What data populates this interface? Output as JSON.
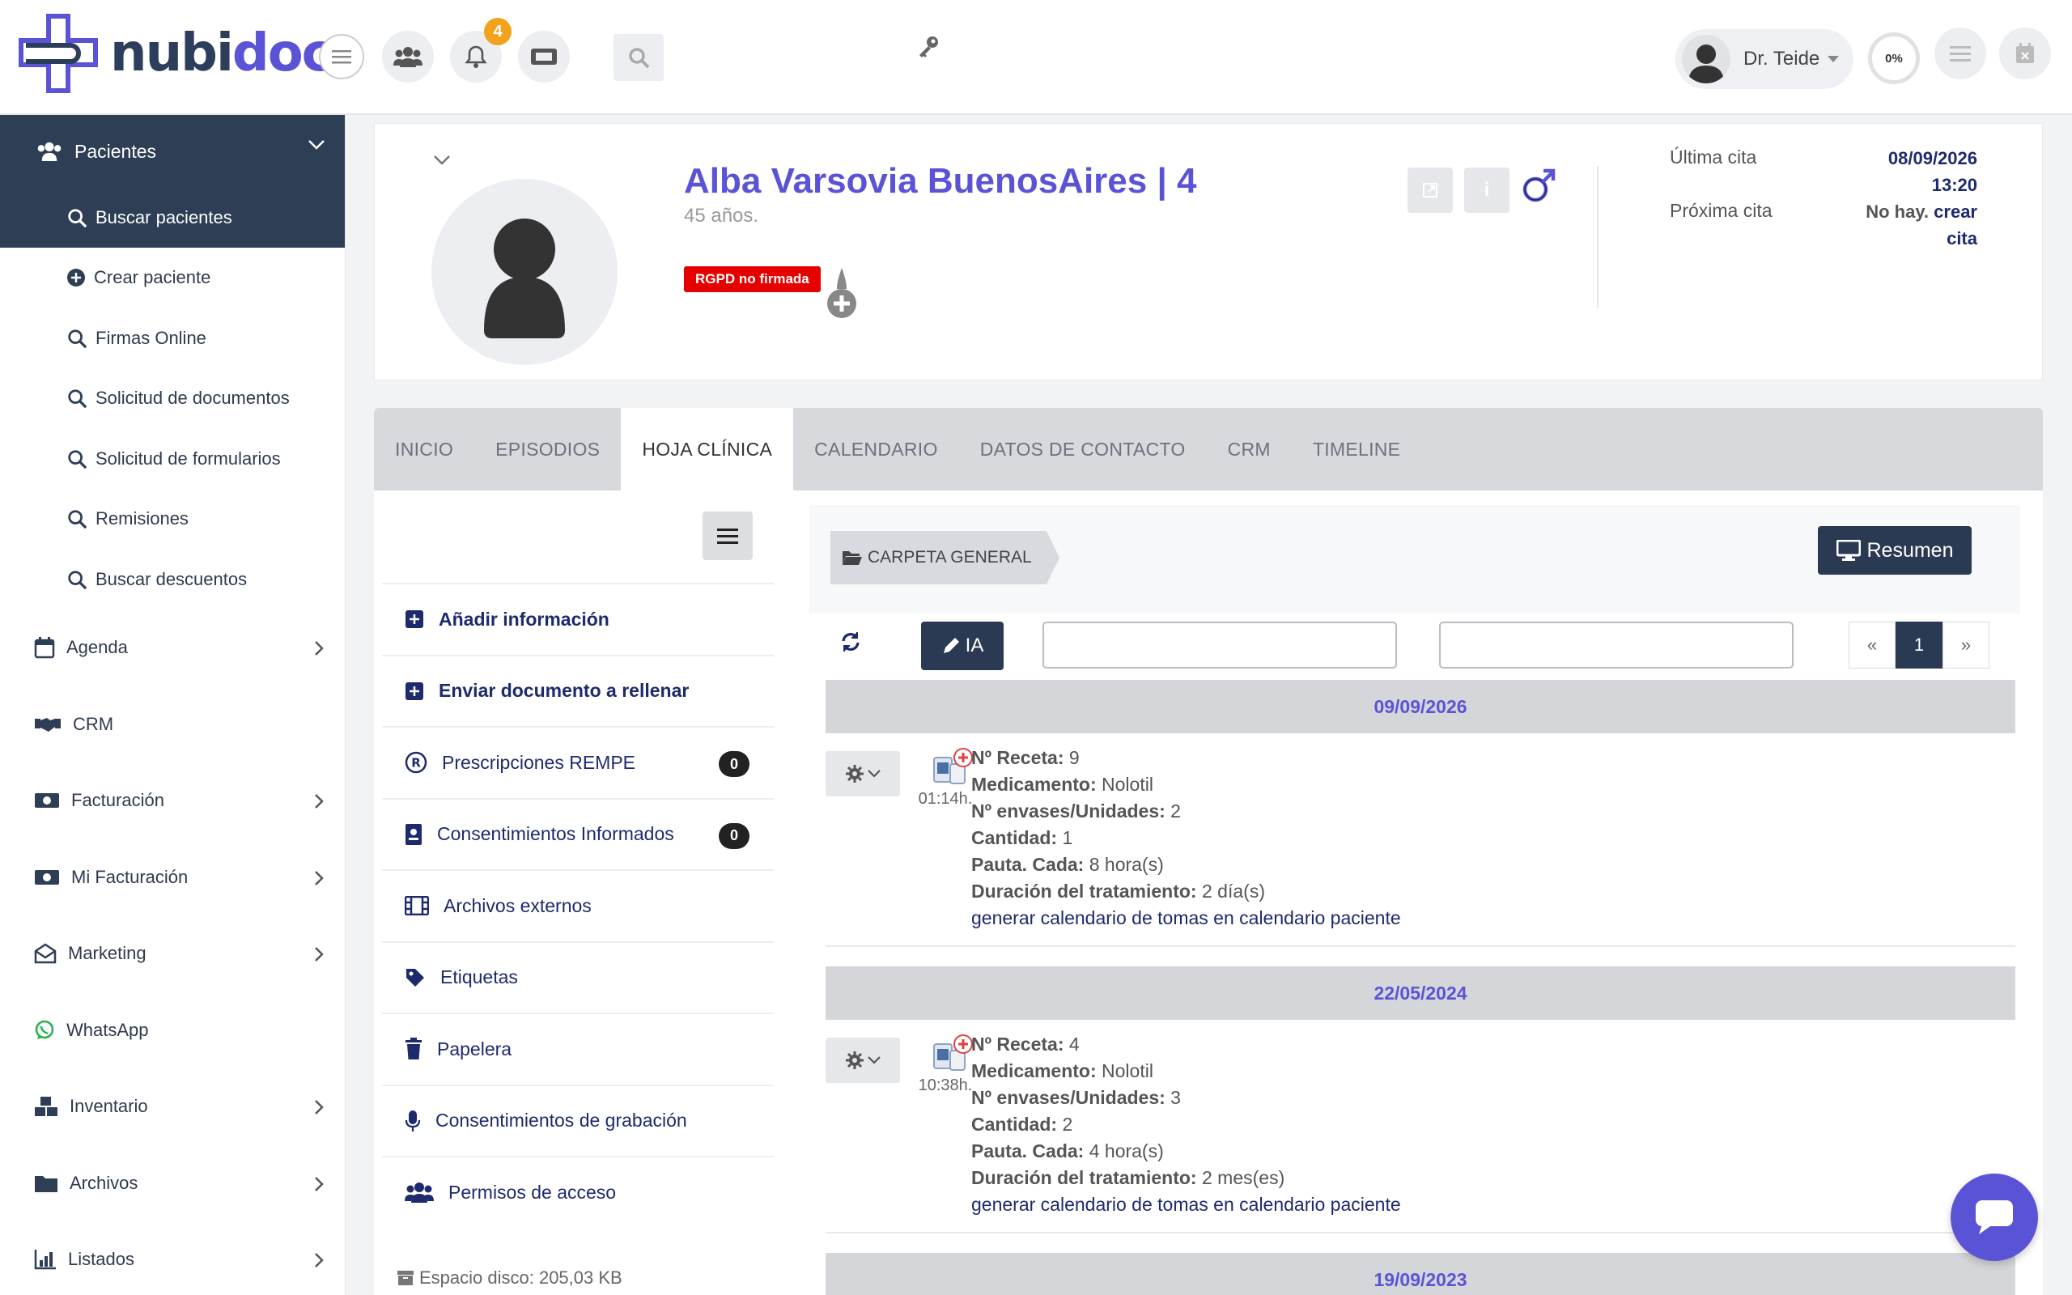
{
  "app": {
    "logo_part1": "nubi",
    "logo_part2": "doc"
  },
  "header": {
    "notifications_count": "4",
    "user_name": "Dr. Teide",
    "progress_label": "0%"
  },
  "sidebar": {
    "section": "Pacientes",
    "active_sub": "Buscar pacientes",
    "sub_items": [
      "Crear paciente",
      "Firmas Online",
      "Solicitud de documentos",
      "Solicitud de formularios",
      "Remisiones",
      "Buscar descuentos"
    ],
    "items": [
      "Agenda",
      "CRM",
      "Facturación",
      "Mi Facturación",
      "Marketing",
      "WhatsApp",
      "Inventario",
      "Archivos",
      "Listados"
    ]
  },
  "patient": {
    "name": "Alba Varsovia BuenosAires | 4",
    "age": "45 años.",
    "rgpd_badge": "RGPD no firmada",
    "last_appt_label": "Última cita",
    "last_appt_date": "08/09/2026",
    "last_appt_time": "13:20",
    "next_appt_label": "Próxima cita",
    "next_appt_none": "No hay.",
    "next_appt_link1": "crear",
    "next_appt_link2": "cita",
    "info_btn": "i"
  },
  "tabs": [
    "INICIO",
    "EPISODIOS",
    "HOJA CLÍNICA",
    "CALENDARIO",
    "DATOS DE CONTACTO",
    "CRM",
    "TIMELINE"
  ],
  "left_menu": {
    "items": [
      {
        "label": "Añadir información"
      },
      {
        "label": "Enviar documento a rellenar"
      },
      {
        "label": "Prescripciones REMPE",
        "count": "0"
      },
      {
        "label": "Consentimientos Informados",
        "count": "0"
      },
      {
        "label": "Archivos externos"
      },
      {
        "label": "Etiquetas"
      },
      {
        "label": "Papelera"
      },
      {
        "label": "Consentimientos de grabación"
      },
      {
        "label": "Permisos de acceso"
      }
    ],
    "disk_space": "Espacio disco: 205,03 KB"
  },
  "folder": {
    "breadcrumb": "CARPETA GENERAL",
    "summary_button": "Resumen",
    "ia_button": "IA",
    "pager": {
      "prev": "«",
      "current": "1",
      "next": "»"
    }
  },
  "entries": [
    {
      "date": "09/09/2026",
      "time": "01:14h.",
      "receta_label": "Nº Receta:",
      "receta": "9",
      "medicamento_label": "Medicamento:",
      "medicamento": "Nolotil",
      "envases_label": "Nº envases/Unidades:",
      "envases": "2",
      "cantidad_label": "Cantidad:",
      "cantidad": "1",
      "pauta_label": "Pauta. Cada:",
      "pauta": "8 hora(s)",
      "duracion_label": "Duración del tratamiento:",
      "duracion": "2 día(s)",
      "link": "generar calendario de tomas en calendario paciente"
    },
    {
      "date": "22/05/2024",
      "time": "10:38h.",
      "receta_label": "Nº Receta:",
      "receta": "4",
      "medicamento_label": "Medicamento:",
      "medicamento": "Nolotil",
      "envases_label": "Nº envases/Unidades:",
      "envases": "3",
      "cantidad_label": "Cantidad:",
      "cantidad": "2",
      "pauta_label": "Pauta. Cada:",
      "pauta": "4 hora(s)",
      "duracion_label": "Duración del tratamiento:",
      "duracion": "2 mes(es)",
      "link": "generar calendario de tomas en calendario paciente"
    },
    {
      "date": "19/09/2023"
    }
  ]
}
